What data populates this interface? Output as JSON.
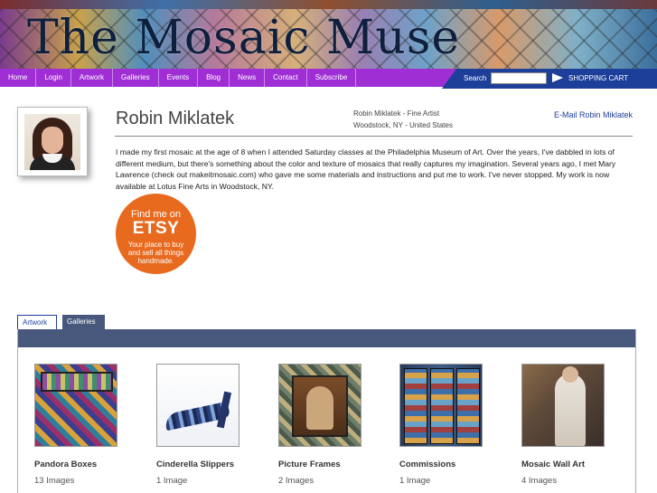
{
  "site": {
    "title": "The Mosaic Muse"
  },
  "nav": {
    "items": [
      "Home",
      "Login",
      "Artwork",
      "Galleries",
      "Events",
      "Blog",
      "News",
      "Contact",
      "Subscribe"
    ],
    "search_label": "Search",
    "search_value": "",
    "cart_label": "SHOPPING CART"
  },
  "profile": {
    "name": "Robin Miklatek",
    "meta_line1": "Robin Miklatek - Fine Artist",
    "meta_line2": "Woodstock, NY - United States",
    "email_link": "E-Mail Robin Miklatek",
    "bio": "I made my first mosaic at the age of 8 when I attended Saturday classes at the Philadelphia Museum of Art. Over the years, I've dabbled in lots of different medium, but there's something about the color and texture of mosaics that really captures my imagination. Several years ago, I met Mary Lawrence (check out makeitmosaic.com) who gave me some materials and instructions and put me to work. I've never stopped. My work is now available at Lotus Fine Arts in Woodstock, NY."
  },
  "etsy": {
    "line1": "Find me on",
    "brand": "ETSY",
    "tagline": "Your place to buy and sell all things handmade.",
    "color": "#e76a1f"
  },
  "tabs": {
    "artwork": "Artwork",
    "galleries": "Galleries",
    "active": "Galleries"
  },
  "galleries": [
    {
      "title": "Pandora Boxes",
      "count": "13 Images"
    },
    {
      "title": "Cinderella Slippers",
      "count": "1 Image"
    },
    {
      "title": "Picture Frames",
      "count": "2 Images"
    },
    {
      "title": "Commissions",
      "count": "1 Image"
    },
    {
      "title": "Mosaic Wall Art",
      "count": "4 Images"
    }
  ],
  "colors": {
    "nav_purple": "#9f2fd4",
    "nav_blue": "#1d3f9a",
    "panel_bar": "#48587c"
  }
}
